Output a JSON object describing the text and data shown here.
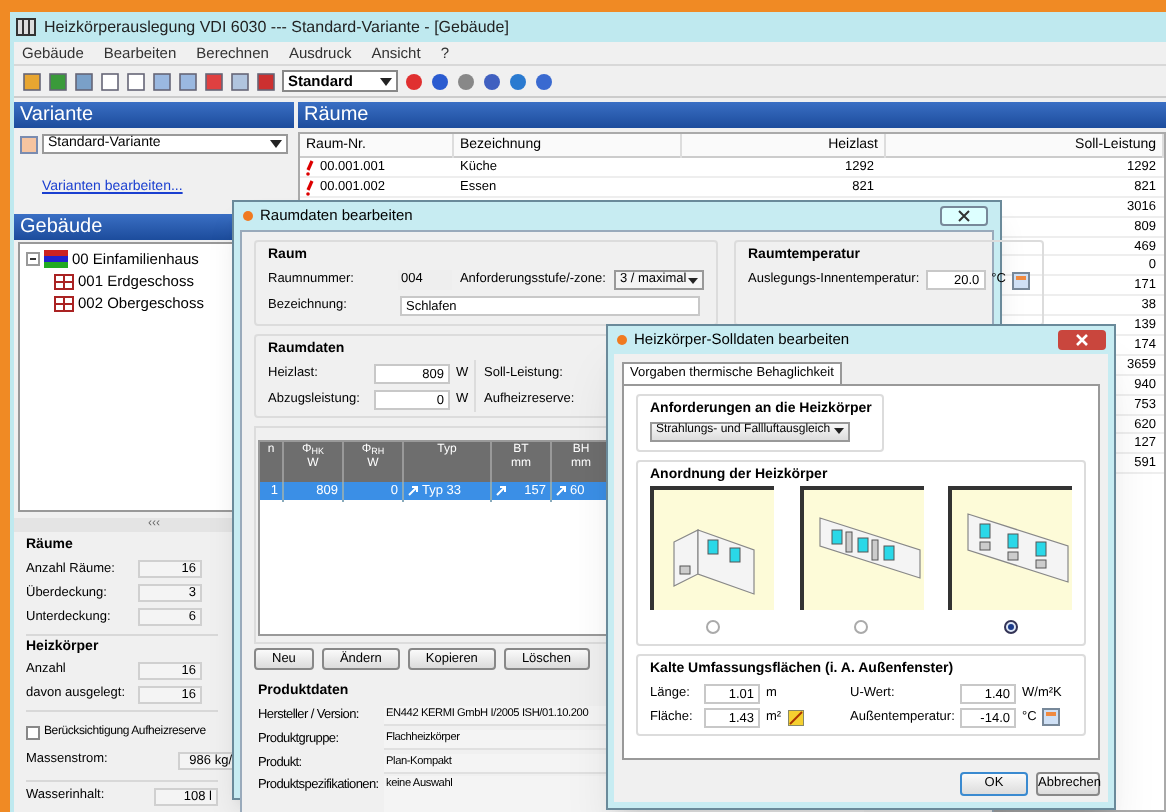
{
  "window": {
    "title": "Heizkörperauslegung VDI 6030 --- Standard-Variante - [Gebäude]"
  },
  "menu": [
    "Gebäude",
    "Bearbeiten",
    "Berechnen",
    "Ausdruck",
    "Ansicht",
    "?"
  ],
  "toolbar": {
    "profile": "Standard"
  },
  "variante": {
    "title": "Variante",
    "selected": "Standard-Variante",
    "link": "Varianten bearbeiten..."
  },
  "gebaeude": {
    "title": "Gebäude",
    "tree": [
      {
        "label": "00 Einfamilienhaus",
        "expanded": true,
        "children": [
          {
            "label": "001 Erdgeschoss"
          },
          {
            "label": "002 Obergeschoss"
          }
        ]
      }
    ]
  },
  "summary": {
    "splitter": "‹‹‹",
    "groups": [
      {
        "title": "Räume",
        "fields": [
          {
            "label": "Anzahl Räume:",
            "value": "16"
          },
          {
            "label": "Überdeckung:",
            "value": "3"
          },
          {
            "label": "Unterdeckung:",
            "value": "6"
          }
        ]
      },
      {
        "title": "Heizkörper",
        "fields": [
          {
            "label": "Anzahl",
            "value": "16"
          },
          {
            "label": "davon ausgelegt:",
            "value": "16"
          }
        ]
      }
    ],
    "reserve": {
      "label": "Berücksichtigung Aufheizreserve",
      "checked": false
    },
    "massenstrom": {
      "label": "Massenstrom:",
      "value": "986 kg/"
    },
    "wasserinhalt": {
      "label": "Wasserinhalt:",
      "value": "108 l"
    }
  },
  "raeume": {
    "title": "Räume",
    "columns": [
      "Raum-Nr.",
      "Bezeichnung",
      "Heizlast",
      "Soll-Leistung"
    ],
    "rows": [
      {
        "nr": "00.001.001",
        "name": "Küche",
        "heizlast": "1292",
        "soll": "1292"
      },
      {
        "nr": "00.001.002",
        "name": "Essen",
        "heizlast": "821",
        "soll": "821"
      },
      {
        "soll": "3016"
      },
      {
        "soll": "809"
      },
      {
        "soll": "469"
      },
      {
        "soll": "0"
      },
      {
        "soll": "171"
      },
      {
        "soll": "38"
      },
      {
        "soll": "139"
      },
      {
        "soll": "174"
      },
      {
        "soll": "3659"
      },
      {
        "soll": "940"
      },
      {
        "soll": "753"
      },
      {
        "soll": "620"
      },
      {
        "soll": "127"
      },
      {
        "soll": "591"
      }
    ]
  },
  "raumdialog": {
    "title": "Raumdaten bearbeiten",
    "raum": {
      "title": "Raum",
      "nummer_label": "Raumnummer:",
      "nummer": "004",
      "zone_label": "Anforderungsstufe/-zone:",
      "zone": "3 / maximal",
      "bez_label": "Bezeichnung:",
      "bez": "Schlafen"
    },
    "temperatur": {
      "title": "Raumtemperatur",
      "label": "Auslegungs-Innentemperatur:",
      "value": "20.0",
      "unit": "°C"
    },
    "raumdaten": {
      "title": "Raumdaten",
      "heizlast_label": "Heizlast:",
      "heizlast": "809",
      "heizlast_unit": "W",
      "abzug_label": "Abzugsleistung:",
      "abzug": "0",
      "abzug_unit": "W",
      "soll_label": "Soll-Leistung:",
      "reserve_label": "Aufheizreserve:"
    },
    "columns": [
      {
        "symbol": "n"
      },
      {
        "symbol": "Φ$_{HK}$",
        "unit": "W"
      },
      {
        "symbol": "Φ$_{RH}$",
        "unit": "W"
      },
      {
        "symbol": "Typ"
      },
      {
        "symbol": "BT",
        "unit": "mm"
      },
      {
        "symbol": "BH",
        "unit": "mm"
      }
    ],
    "rows": [
      {
        "selected": true,
        "cells": [
          "1",
          "809",
          "0",
          "Typ 33",
          "157",
          "60"
        ]
      }
    ],
    "buttons": [
      "Neu",
      "Ändern",
      "Kopieren",
      "Löschen"
    ],
    "produkt": {
      "title": "Produktdaten",
      "fields": [
        {
          "label": "Hersteller / Version:",
          "value": "EN442 KERMI GmbH I/2005 ISH/01.10.200"
        },
        {
          "label": "Produktgruppe:",
          "value": "Flachheizkörper"
        },
        {
          "label": "Produkt:",
          "value": "Plan-Kompakt"
        },
        {
          "label": "Produktspezifikationen:",
          "value": "keine Auswahl"
        }
      ]
    }
  },
  "solldialog": {
    "title": "Heizkörper-Solldaten bearbeiten",
    "tab": "Vorgaben thermische Behaglichkeit",
    "anforderungen": {
      "title": "Anforderungen an die Heizkörper",
      "value": "Strahlungs- und Fallluftausgleich"
    },
    "anordnung": {
      "title": "Anordnung der Heizkörper",
      "options": [
        {
          "kind": "corner",
          "selected": false
        },
        {
          "kind": "between",
          "selected": false
        },
        {
          "kind": "below",
          "selected": true
        }
      ]
    },
    "kalt": {
      "title": "Kalte Umfassungsflächen (i. A. Außenfenster)",
      "fields": [
        {
          "label": "Länge:",
          "value": "1.01",
          "unit": "m"
        },
        {
          "label": "U-Wert:",
          "value": "1.40",
          "unit": "W/m²K"
        },
        {
          "label": "Fläche:",
          "value": "1.43",
          "unit": "m²"
        },
        {
          "label": "Außentemperatur:",
          "value": "-14.0",
          "unit": "°C"
        }
      ]
    },
    "buttons": [
      "OK",
      "Abbrechen"
    ]
  }
}
